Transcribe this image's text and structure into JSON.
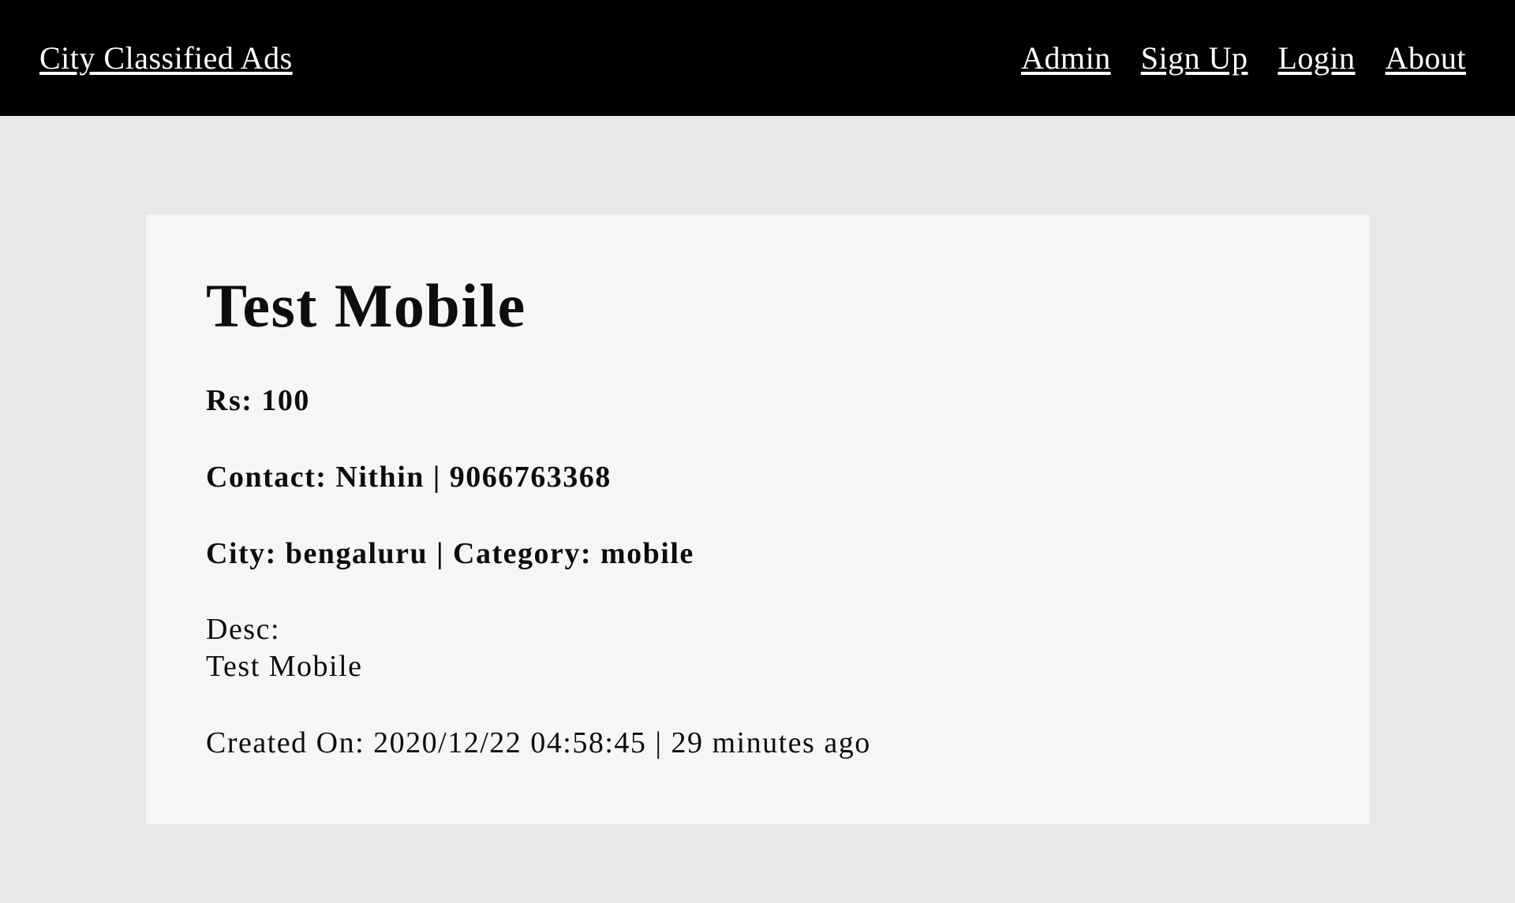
{
  "navbar": {
    "brand": "City Classified Ads",
    "links": [
      "Admin",
      "Sign Up",
      "Login",
      "About"
    ]
  },
  "ad": {
    "title": "Test Mobile",
    "price_line": "Rs: 100",
    "contact_line": "Contact: Nithin | 9066763368",
    "city_category_line": "City: bengaluru | Category: mobile",
    "desc_label": "Desc:",
    "desc_text": "Test Mobile",
    "created_line": "Created On: 2020/12/22 04:58:45 | 29 minutes ago"
  }
}
